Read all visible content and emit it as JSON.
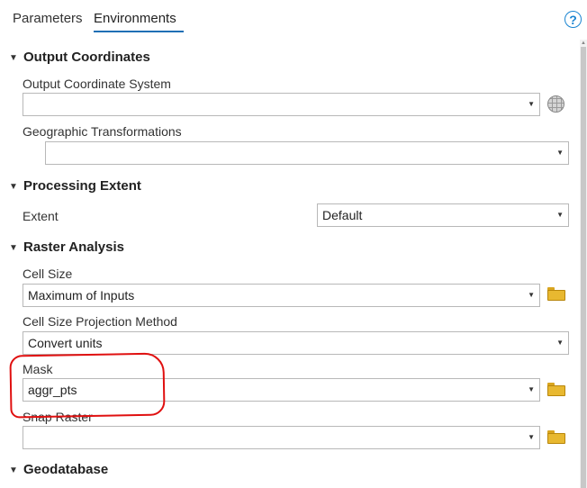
{
  "tabs": [
    {
      "label": "Parameters",
      "active": false
    },
    {
      "label": "Environments",
      "active": true
    }
  ],
  "help_icon": "?",
  "sections": {
    "output_coordinates": {
      "title": "Output Coordinates",
      "output_coordinate_system": {
        "label": "Output Coordinate System",
        "value": ""
      },
      "geographic_transformations": {
        "label": "Geographic Transformations",
        "value": ""
      }
    },
    "processing_extent": {
      "title": "Processing Extent",
      "extent": {
        "label": "Extent",
        "value": "Default"
      }
    },
    "raster_analysis": {
      "title": "Raster Analysis",
      "cell_size": {
        "label": "Cell Size",
        "value": "Maximum of Inputs"
      },
      "cell_size_projection_method": {
        "label": "Cell Size Projection Method",
        "value": "Convert units"
      },
      "mask": {
        "label": "Mask",
        "value": "aggr_pts"
      },
      "snap_raster": {
        "label": "Snap Raster",
        "value": ""
      }
    },
    "geodatabase": {
      "title": "Geodatabase"
    }
  },
  "colors": {
    "accent": "#1f6fb5",
    "annotation": "#e01010",
    "folder": "#e8b830"
  }
}
